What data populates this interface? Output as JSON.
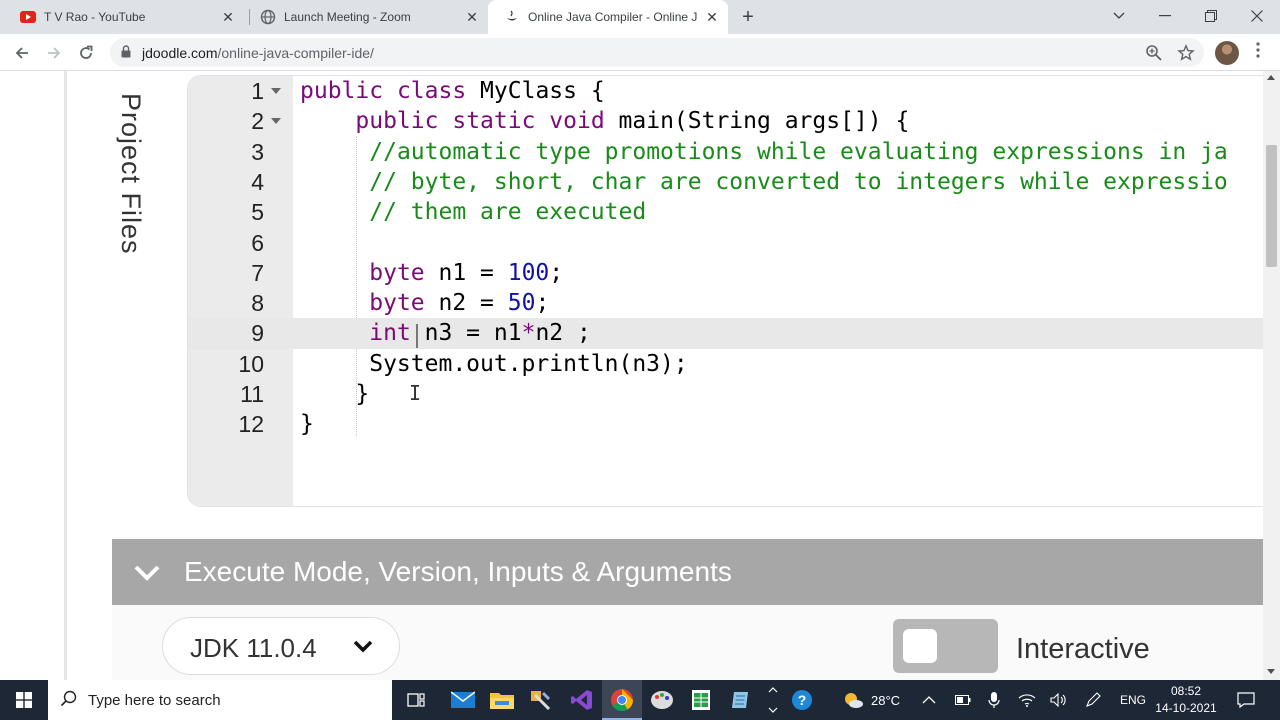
{
  "browser": {
    "tabs": [
      {
        "title": "T V Rao - YouTube",
        "icon": "youtube-icon"
      },
      {
        "title": "Launch Meeting - Zoom",
        "icon": "globe-icon"
      },
      {
        "title": "Online Java Compiler - Online Ja",
        "icon": "jdoodle-icon",
        "active": true
      }
    ],
    "url_host": "jdoodle.com",
    "url_path": "/online-java-compiler-ide/"
  },
  "sidebar": {
    "project_files_label": "Project Files"
  },
  "editor": {
    "active_line": 9,
    "lines": [
      {
        "n": "1",
        "code": "public class MyClass {"
      },
      {
        "n": "2",
        "code": "    public static void main(String args[]) {"
      },
      {
        "n": "3",
        "code": "     //automatic type promotions while evaluating expressions in ja"
      },
      {
        "n": "4",
        "code": "     // byte, short, char are converted to integers while expressio"
      },
      {
        "n": "5",
        "code": "     // them are executed"
      },
      {
        "n": "6",
        "code": ""
      },
      {
        "n": "7",
        "code": "     byte n1 = 100;"
      },
      {
        "n": "8",
        "code": "     byte n2 = 50;"
      },
      {
        "n": "9",
        "code": "     int n3 = n1*n2 ;"
      },
      {
        "n": "10",
        "code": "     System.out.println(n3);"
      },
      {
        "n": "11",
        "code": "    }"
      },
      {
        "n": "12",
        "code": "}"
      }
    ]
  },
  "execute": {
    "header_label": "Execute Mode, Version, Inputs & Arguments",
    "jdk_version": "JDK 11.0.4",
    "interactive_label": "Interactive"
  },
  "taskbar": {
    "search_placeholder": "Type here to search",
    "weather": "28°C",
    "language": "ENG",
    "time": "08:52",
    "date": "14-10-2021"
  },
  "colors": {
    "keyword": "#7a0a78",
    "comment": "#1a8a1a",
    "number": "#1111aa",
    "exec_header_bg": "#a7a7a7",
    "taskbar_bg": "#1d2736"
  }
}
